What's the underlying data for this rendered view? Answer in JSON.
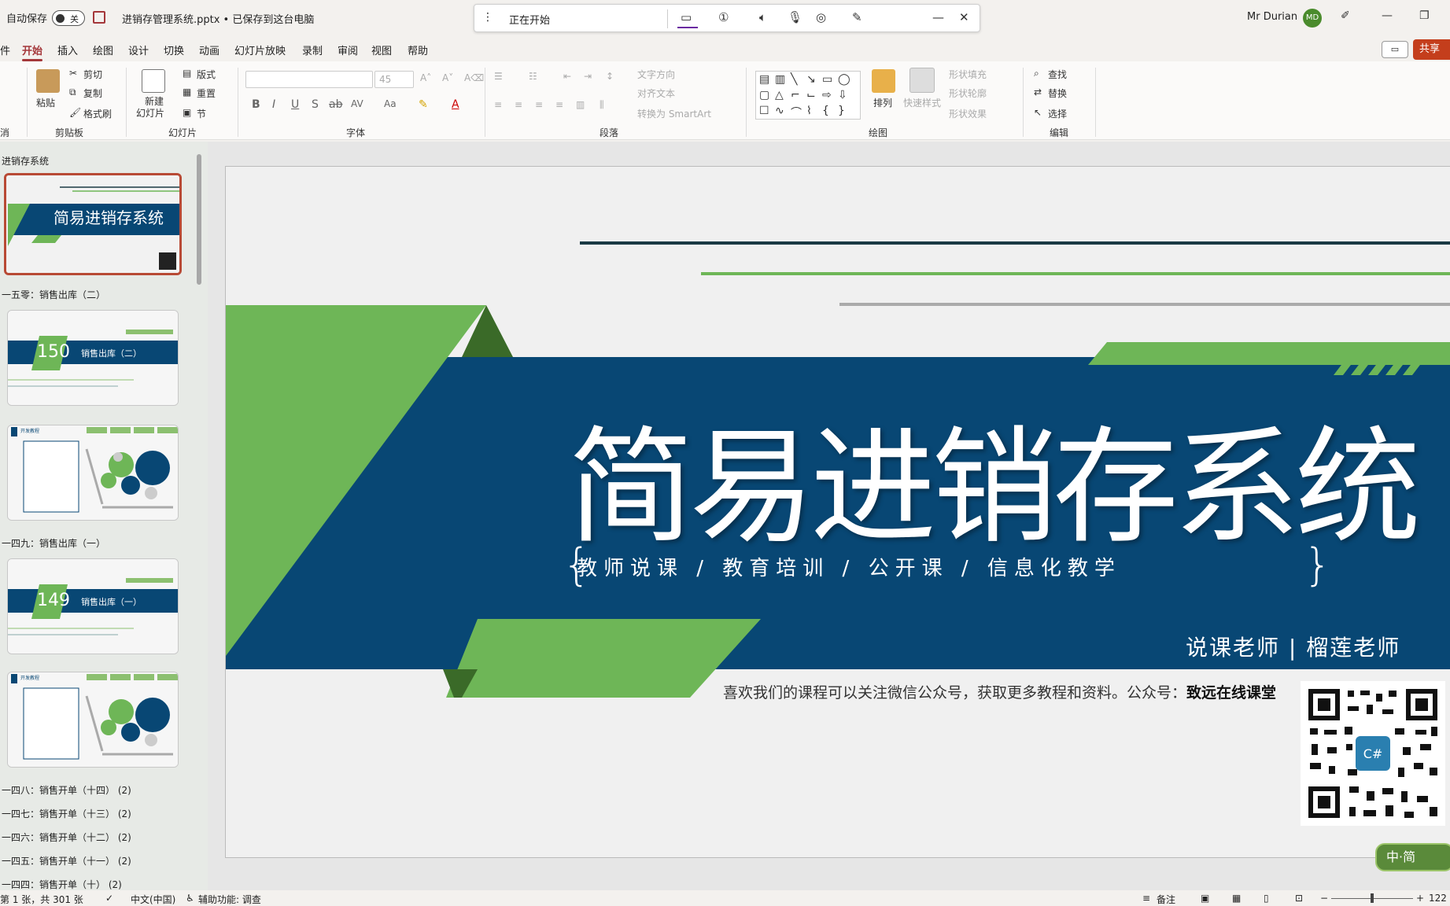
{
  "titlebar": {
    "autosave_label": "自动保存",
    "autosave_state": "关",
    "filename": "进销存管理系统.pptx • 已保存到这台电脑",
    "command_bar_text": "正在开始",
    "user_name": "Mr Durian",
    "user_initials": "MD"
  },
  "tabs": [
    "件",
    "开始",
    "插入",
    "绘图",
    "设计",
    "切换",
    "动画",
    "幻灯片放映",
    "录制",
    "审阅",
    "视图",
    "帮助"
  ],
  "active_tab": "开始",
  "share_label": "共享",
  "ribbon": {
    "undo_group_label": "消",
    "clipboard": {
      "paste": "粘贴",
      "cut": "剪切",
      "copy": "复制",
      "format_painter": "格式刷",
      "label": "剪贴板"
    },
    "slides": {
      "new_slide": "新建",
      "new_slide2": "幻灯片",
      "layout": "版式",
      "reset": "重置",
      "section": "节",
      "label": "幻灯片"
    },
    "font": {
      "font_size": "45",
      "label": "字体",
      "bold": "B",
      "italic": "I",
      "underline": "U",
      "strike": "S",
      "spacing": "AV",
      "case": "Aa"
    },
    "paragraph": {
      "text_direction": "文字方向",
      "align_text": "对齐文本",
      "smartart": "转换为 SmartArt",
      "label": "段落"
    },
    "drawing": {
      "arrange": "排列",
      "quick_styles": "快速样式",
      "shape_fill": "形状填充",
      "shape_outline": "形状轮廓",
      "shape_effects": "形状效果",
      "label": "绘图"
    },
    "editing": {
      "find": "查找",
      "replace": "替换",
      "select": "选择",
      "label": "编辑"
    }
  },
  "left_panel": {
    "sections": [
      "进销存系统",
      "一五零：销售出库（二）",
      "一四九：销售出库（一）",
      "一四八：销售开单（十四） (2)",
      "一四七：销售开单（十三） (2)",
      "一四六：销售开单（十二） (2)",
      "一四五：销售开单（十一） (2)",
      "一四四：销售开单（十） (2)"
    ],
    "thumbs": [
      {
        "kind": "title",
        "text": "简易进销存系统"
      },
      {
        "kind": "chapter",
        "number": "150",
        "text": "销售出库（二）"
      },
      {
        "kind": "lesson",
        "text": "开发教程"
      },
      {
        "kind": "chapter",
        "number": "149",
        "text": "销售出库（一）"
      },
      {
        "kind": "lesson",
        "text": "开发教程"
      }
    ]
  },
  "slide": {
    "title": "简易进销存系统",
    "subtitle": "教师说课 / 教育培训 / 公开课 / 信息化教学",
    "teacher": "说课老师 | 榴莲老师",
    "note_prefix": "喜欢我们的课程可以关注微信公众号，获取更多教程和资料。公众号：",
    "note_bold": "致远在线课堂",
    "colors": {
      "navy": "#084774",
      "green": "#6eb657",
      "dark_green": "#3a6a28",
      "line_dark": "#1a3a44",
      "line_gray": "#aaaaaa"
    }
  },
  "statusbar": {
    "slide_info": "第 1 张，共 301 张",
    "language": "中文(中国)",
    "accessibility": "辅助功能: 调查",
    "notes": "备注",
    "zoom": "122"
  },
  "ime_label": "中·简"
}
